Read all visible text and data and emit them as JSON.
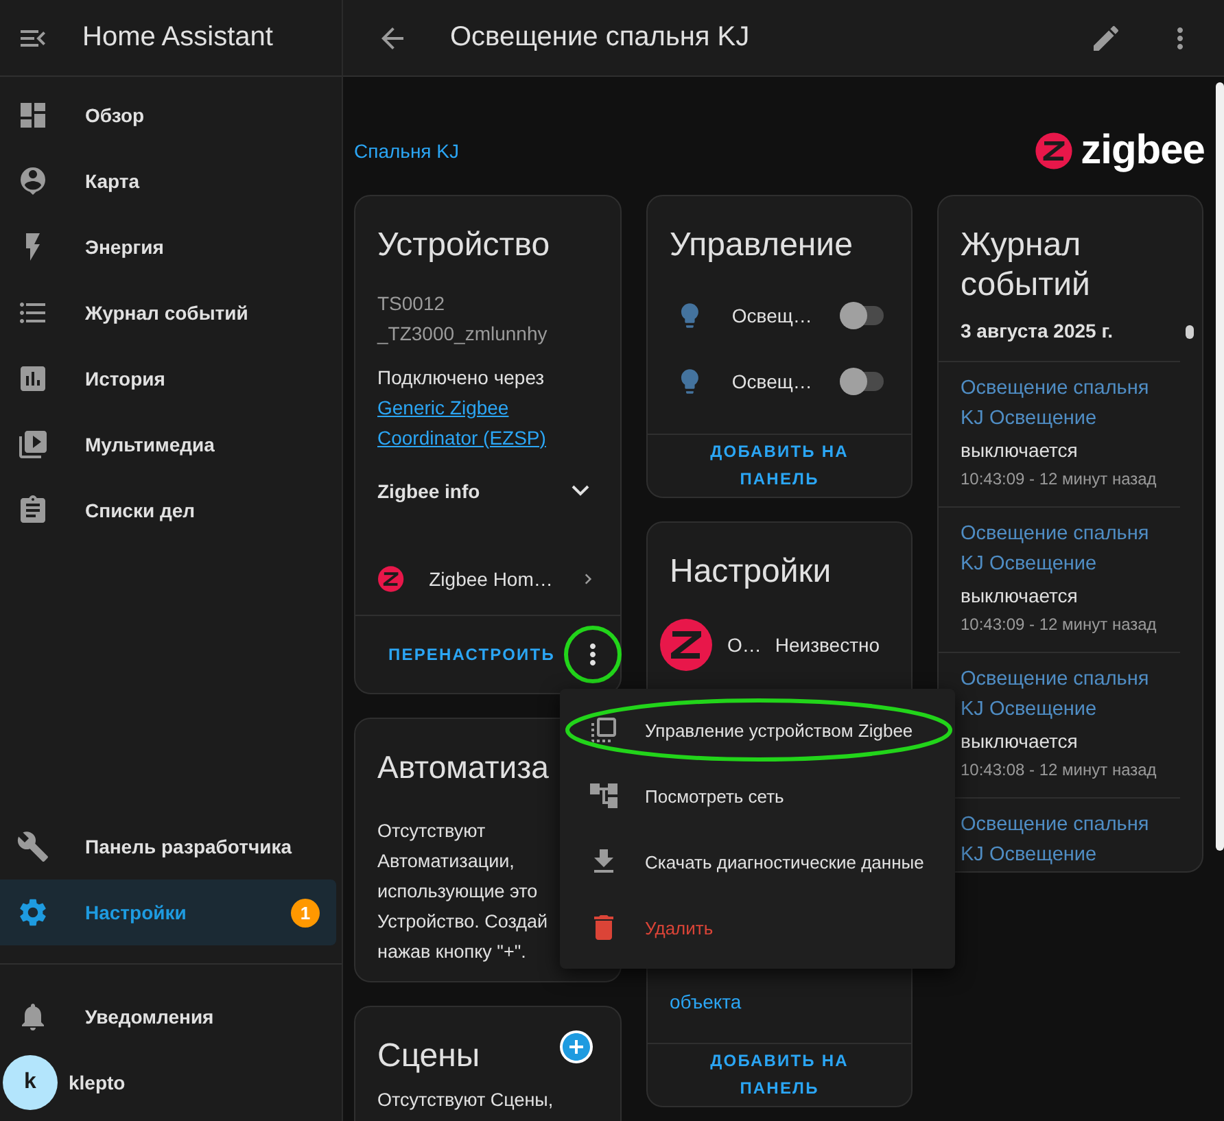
{
  "sidebar": {
    "title": "Home Assistant",
    "items": [
      {
        "label": "Обзор",
        "selected": false
      },
      {
        "label": "Карта",
        "selected": false
      },
      {
        "label": "Энергия",
        "selected": false
      },
      {
        "label": "Журнал событий",
        "selected": false
      },
      {
        "label": "История",
        "selected": false
      },
      {
        "label": "Мультимедиа",
        "selected": false
      },
      {
        "label": "Списки дел",
        "selected": false
      }
    ],
    "bottom_items": [
      {
        "label": "Панель разработчика",
        "selected": false
      },
      {
        "label": "Настройки",
        "selected": true,
        "badge": "1"
      }
    ],
    "notifications": "Уведомления",
    "user": {
      "initial": "k",
      "name": "klepto"
    }
  },
  "header": {
    "title": "Освещение спальня KJ"
  },
  "breadcrumb": "Спальня KJ",
  "logo": "zigbee",
  "device_card": {
    "title": "Устройство",
    "model": "TS0012",
    "manufacturer": "_TZ3000_zmlunnhy",
    "connected_label": "Подключено через",
    "connected_link": "Generic Zigbee Coordinator (EZSP)",
    "section": {
      "label": "Zigbee info",
      "expanded": false
    },
    "integration": "Zigbee Hom…",
    "action": "ПЕРЕНАСТРОИТЬ"
  },
  "automation_card": {
    "title": "Автоматиза",
    "lines": [
      "Отсутствуют",
      "Автоматизации,",
      "использующие это",
      "Устройство. Создай",
      "нажав кнопку \"+\"."
    ]
  },
  "scenes_card": {
    "title": "Сцены",
    "text": "Отсутствуют Сцены,"
  },
  "control_card": {
    "title": "Управление",
    "entities": [
      {
        "name": "Освещ…",
        "on": false
      },
      {
        "name": "Освещ…",
        "on": false
      }
    ],
    "action": "ДОБАВИТЬ НА ПАНЕЛЬ"
  },
  "settings_card": {
    "title": "Настройки",
    "entities": [
      {
        "name": "О…",
        "state": "Неизвестно"
      }
    ],
    "hidden_link": "объекта",
    "action": "ДОБАВИТЬ НА ПАНЕЛЬ"
  },
  "journal": {
    "title": "Журнал событий",
    "date": "3 августа 2025 г.",
    "entries": [
      {
        "name": "Освещение спальня KJ Освещение",
        "action": "выключается",
        "time": "10:43:09 - 12 минут назад"
      },
      {
        "name": "Освещение спальня KJ Освещение",
        "action": "выключается",
        "time": "10:43:09 - 12 минут назад"
      },
      {
        "name": "Освещение спальня KJ Освещение",
        "action": "выключается",
        "time": "10:43:08 - 12 минут назад"
      },
      {
        "name": "Освещение спальня KJ Освещение"
      }
    ]
  },
  "menu": {
    "items": [
      {
        "label": "Управление устройством Zigbee",
        "kind": "normal",
        "highlighted": true
      },
      {
        "label": "Посмотреть сеть",
        "kind": "normal",
        "highlighted": false
      },
      {
        "label": "Скачать диагностические данные",
        "kind": "normal",
        "highlighted": false
      },
      {
        "label": "Удалить",
        "kind": "danger",
        "highlighted": false
      }
    ]
  }
}
